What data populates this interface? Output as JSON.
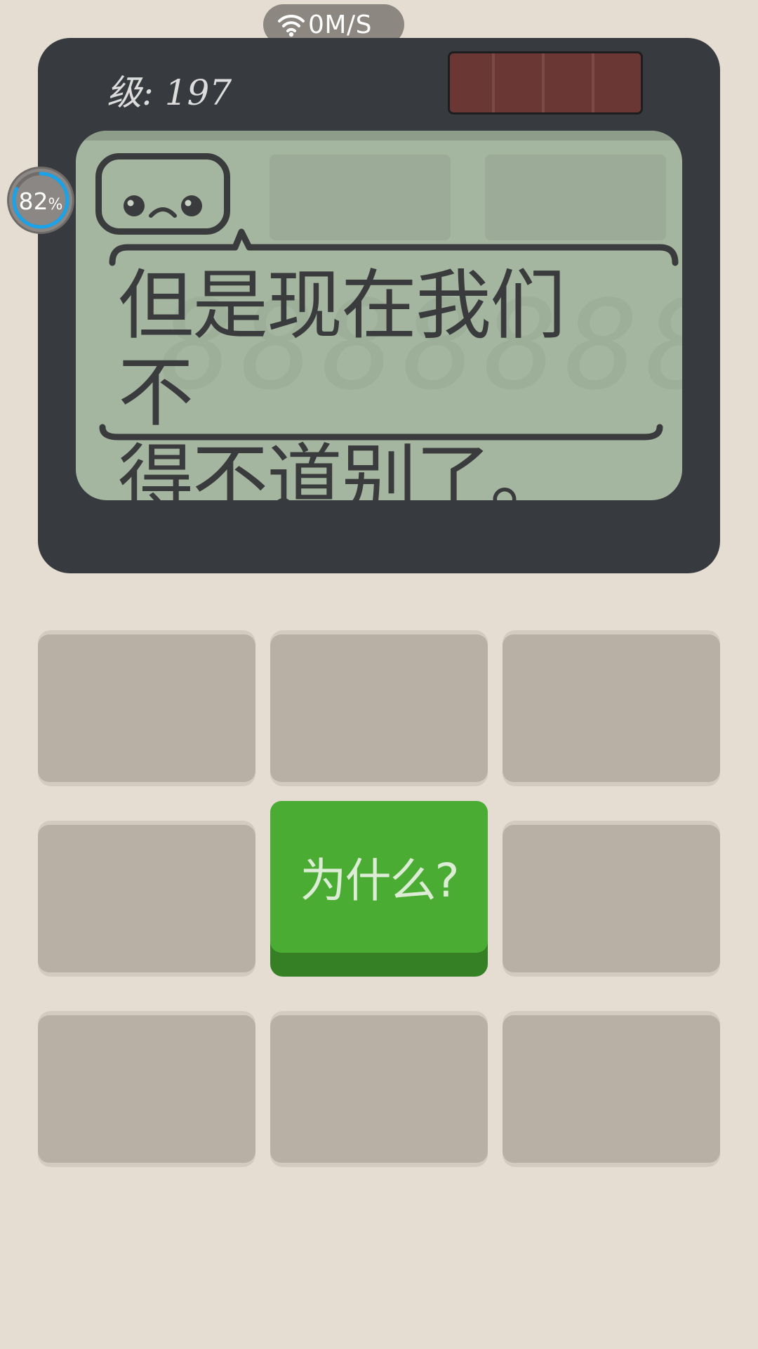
{
  "status": {
    "network_speed": "0M/S",
    "progress_percent": 82,
    "progress_number": "82",
    "progress_unit": "%"
  },
  "device": {
    "level_text": "级: 197",
    "battery_segments": 3,
    "face_icon": "sad-face-icon",
    "dialog_line1": "但是现在我们不",
    "dialog_line2": "得不道别了。",
    "ghost_digits": "8888888"
  },
  "answers": {
    "active_label": "为什么?"
  },
  "colors": {
    "background": "#e5ddd1",
    "device_body": "#373b40",
    "lcd": "#a5b6a0",
    "key_idle": "#b8b0a5",
    "key_active": "#4aac33",
    "progress_ring": "#1aa3e8"
  }
}
